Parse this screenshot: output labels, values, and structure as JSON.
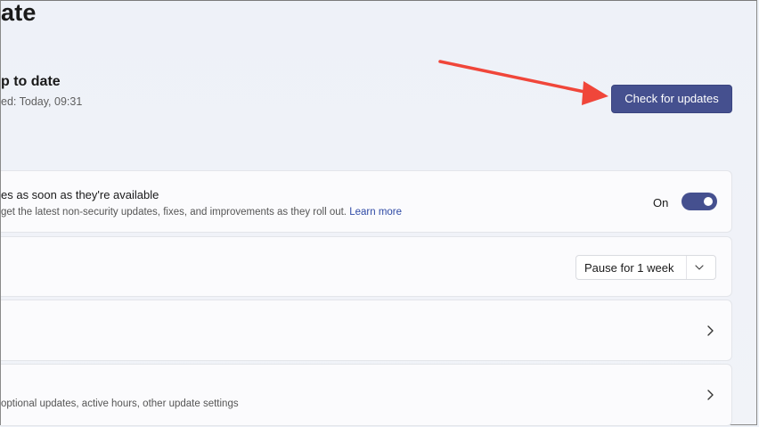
{
  "page": {
    "title": "ate"
  },
  "status": {
    "heading": "p to date",
    "last_checked": "ed: Today, 09:31"
  },
  "actions": {
    "check_updates_label": "Check for updates"
  },
  "annotation": {
    "arrow_color": "#f0463a"
  },
  "cards": {
    "latest_updates": {
      "title": "es as soon as they're available",
      "description": "get the latest non-security updates, fixes, and improvements as they roll out.",
      "link": "Learn more",
      "toggle_label": "On",
      "toggle_state": true
    },
    "pause": {
      "dropdown_value": "Pause for 1 week"
    },
    "history": {},
    "advanced": {
      "description": "optional updates, active hours, other update settings"
    }
  },
  "colors": {
    "accent": "#45508f",
    "link": "#2f4aa5",
    "background": "#eef1f7",
    "card": "#fbfbfd"
  }
}
